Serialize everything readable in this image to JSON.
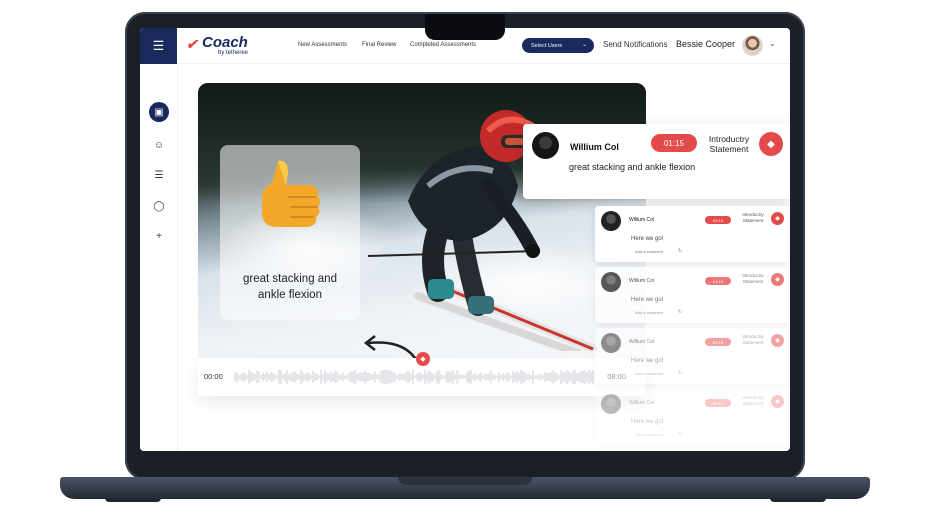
{
  "header": {
    "menu_icon": "hamburger-icon",
    "logo_text": "Coach",
    "logo_sub": "by tetheree",
    "nav": [
      "New Assessments",
      "Final Review",
      "Completed Assessments"
    ],
    "select_users_label": "Select Users",
    "send_notifications_label": "Send Notifications",
    "user_name": "Bessie Cooper"
  },
  "sidebar": {
    "icons": [
      "dashboard-icon",
      "video-icon",
      "checklist-icon",
      "chat-icon",
      "add-icon"
    ]
  },
  "video": {
    "overlay_text": "great stacking and ankle flexion",
    "time_start": "00:00",
    "time_end": "08:00"
  },
  "main_comment": {
    "name": "Willium Col",
    "time": "01:15",
    "type": "Introductry Statement",
    "text": "great stacking and ankle flexion"
  },
  "comments": [
    {
      "name": "Willium Col",
      "time": "01:15",
      "type": "Introductry Statement",
      "text": "Here we go!",
      "add_comment": "Add a comment"
    },
    {
      "name": "Willium Col",
      "time": "01:15",
      "type": "Introductry Statement",
      "text": "Here we go!",
      "add_comment": "Add a comment"
    },
    {
      "name": "Willium Col",
      "time": "01:15",
      "type": "Introductry Statement",
      "text": "Here we go!",
      "add_comment": "Add a comment"
    },
    {
      "name": "Willium Col",
      "time": "01:15",
      "type": "Introductry Statement",
      "text": "Here we go!",
      "add_comment": "Add a comment"
    }
  ],
  "colors": {
    "brand_navy": "#182a5e",
    "accent_red": "#e54a4a"
  }
}
